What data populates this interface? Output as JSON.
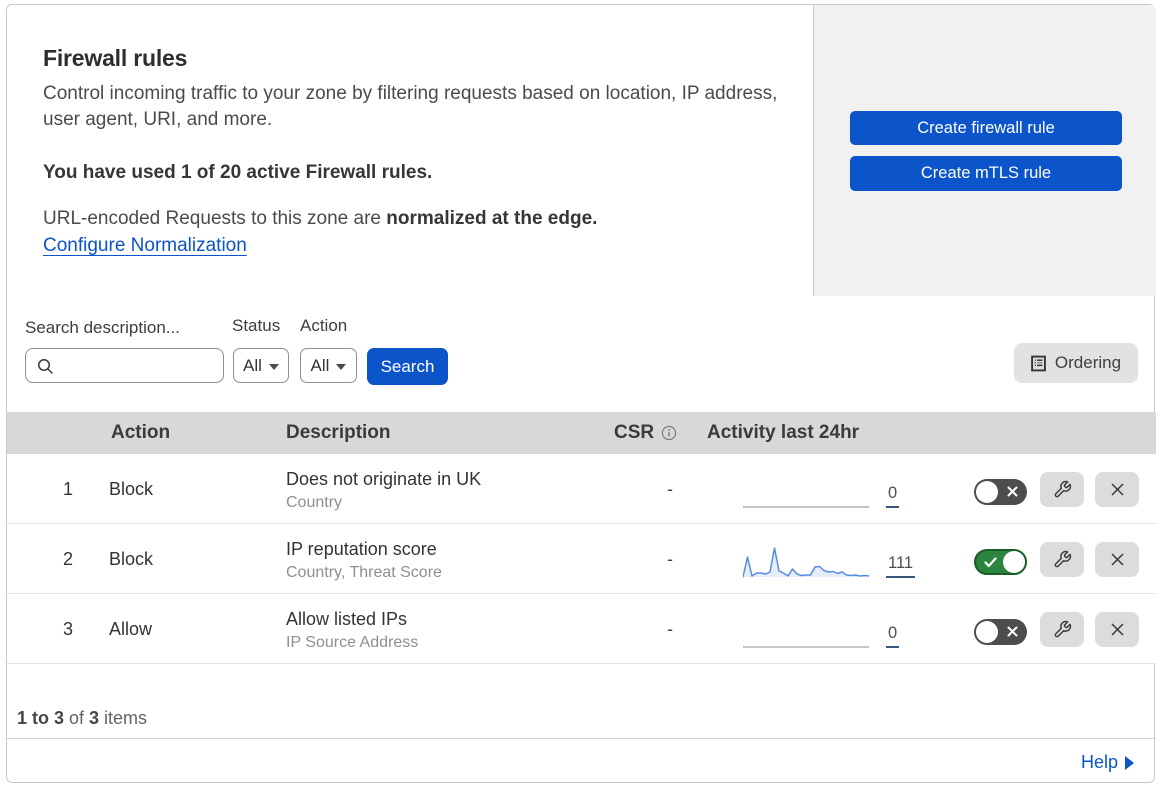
{
  "header": {
    "title": "Firewall rules",
    "description": "Control incoming traffic to your zone by filtering requests based on location, IP address, user agent, URI, and more.",
    "usage_notice": "You have used 1 of 20 active Firewall rules.",
    "normalization_prefix": "URL-encoded Requests to this zone are ",
    "normalization_bold": "normalized at the edge.",
    "normalization_link": "Configure Normalization",
    "create_firewall_button": "Create firewall rule",
    "create_mtls_button": "Create mTLS rule"
  },
  "filters": {
    "search_label": "Search description...",
    "search_value": "",
    "status_label": "Status",
    "status_value": "All",
    "action_label": "Action",
    "action_value": "All",
    "search_button": "Search",
    "ordering_button": "Ordering"
  },
  "table": {
    "headers": {
      "action": "Action",
      "description": "Description",
      "csr": "CSR",
      "activity": "Activity last 24hr"
    },
    "rows": [
      {
        "priority": "1",
        "action": "Block",
        "description": "Does not originate in UK",
        "criteria": "Country",
        "csr": "-",
        "activity_count": "0",
        "enabled": false,
        "sparkline": []
      },
      {
        "priority": "2",
        "action": "Block",
        "description": "IP reputation score",
        "criteria": "Country, Threat Score",
        "csr": "-",
        "activity_count": "111",
        "enabled": true,
        "sparkline": [
          0,
          20,
          1,
          4,
          4,
          3,
          5,
          29,
          6,
          4,
          1,
          8,
          3,
          1.5,
          2,
          2,
          10,
          10.5,
          6.5,
          5,
          5.5,
          3.5,
          5,
          2,
          1.5,
          2,
          1,
          1.5,
          1
        ]
      },
      {
        "priority": "3",
        "action": "Allow",
        "description": "Allow listed IPs",
        "criteria": "IP Source Address",
        "csr": "-",
        "activity_count": "0",
        "enabled": false,
        "sparkline": []
      }
    ]
  },
  "footer": {
    "range_text": "1 to 3",
    "of_text": " of ",
    "total_text": "3",
    "items_text": " items",
    "help_label": "Help"
  },
  "icons": {
    "search": "magnifier",
    "dropdown": "caret-down",
    "ordering": "list-document",
    "csr_info": "info-circle",
    "toggle_off": "x-mark",
    "toggle_on": "check-mark",
    "edit": "wrench",
    "delete": "x-cross",
    "help": "arrow-right-triangle"
  },
  "colors": {
    "accent_blue": "#0b54ca",
    "toggle_on_green": "#2b853e",
    "toggle_off_gray": "#4d4d4d",
    "panel_gray": "#f1f1f1",
    "table_header_gray": "#d8d8d8",
    "sparkline_blue": "#578be0"
  }
}
